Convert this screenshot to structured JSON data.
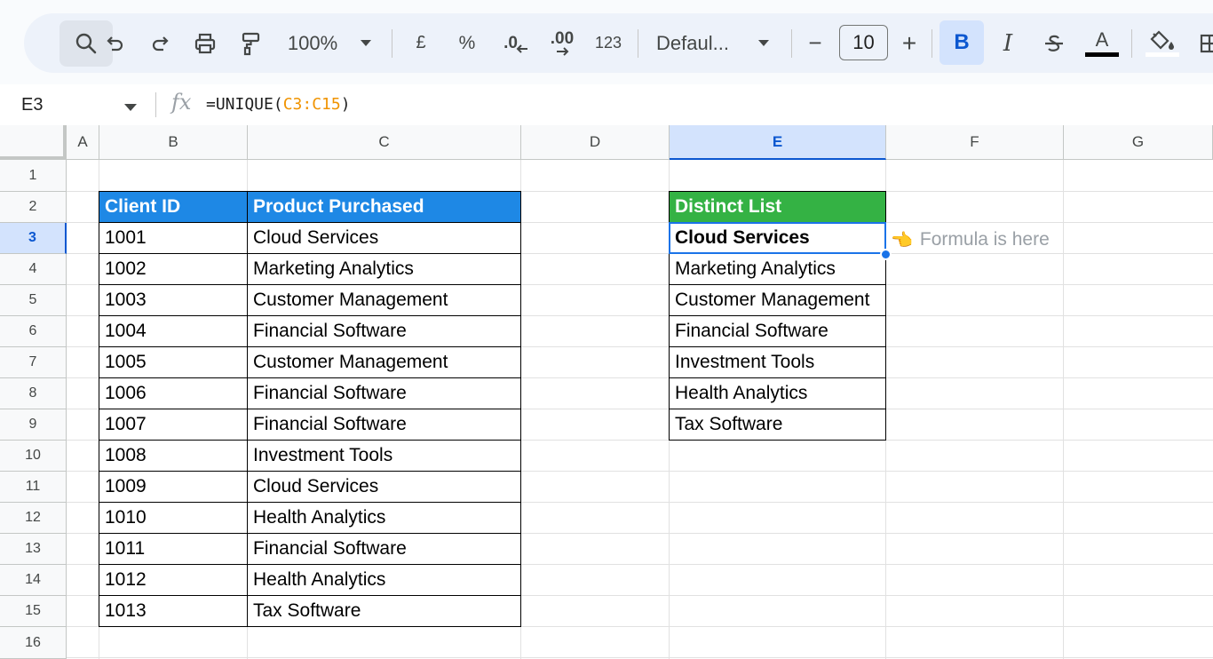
{
  "toolbar": {
    "zoom": "100%",
    "currency": "£",
    "percent": "%",
    "decimal_decrease": ".0",
    "decimal_increase": ".00",
    "number_format": "123",
    "font": "Defaul...",
    "font_size": "10",
    "minus": "−",
    "plus": "+",
    "bold": "B",
    "italic": "I",
    "text_color_letter": "A"
  },
  "formula_bar": {
    "cell_ref": "E3",
    "formula_prefix": "=UNIQUE(",
    "formula_range": "C3:C15",
    "formula_suffix": ")"
  },
  "columns": [
    "A",
    "B",
    "C",
    "D",
    "E",
    "F",
    "G"
  ],
  "selected_column": "E",
  "rows": [
    "1",
    "2",
    "3",
    "4",
    "5",
    "6",
    "7",
    "8",
    "9",
    "10",
    "11",
    "12",
    "13",
    "14",
    "15",
    "16"
  ],
  "selected_row": "3",
  "source_table": {
    "headers": [
      "Client ID",
      "Product Purchased"
    ],
    "rows": [
      [
        "1001",
        "Cloud Services"
      ],
      [
        "1002",
        "Marketing Analytics"
      ],
      [
        "1003",
        "Customer Management"
      ],
      [
        "1004",
        "Financial Software"
      ],
      [
        "1005",
        "Customer Management"
      ],
      [
        "1006",
        "Financial Software"
      ],
      [
        "1007",
        "Financial Software"
      ],
      [
        "1008",
        "Investment Tools"
      ],
      [
        "1009",
        "Cloud Services"
      ],
      [
        "1010",
        "Health Analytics"
      ],
      [
        "1011",
        "Financial Software"
      ],
      [
        "1012",
        "Health Analytics"
      ],
      [
        "1013",
        "Tax Software"
      ]
    ]
  },
  "distinct_table": {
    "header": "Distinct List",
    "items": [
      "Cloud Services",
      "Marketing Analytics",
      "Customer Management",
      "Financial Software",
      "Investment Tools",
      "Health Analytics",
      "Tax Software"
    ]
  },
  "annotation": {
    "hand": "👈",
    "text": "Formula is here"
  },
  "colors": {
    "source_header": "#1e88e5",
    "distinct_header": "#34b244",
    "selection": "#1a73e8",
    "formula_range": "#f09300"
  }
}
